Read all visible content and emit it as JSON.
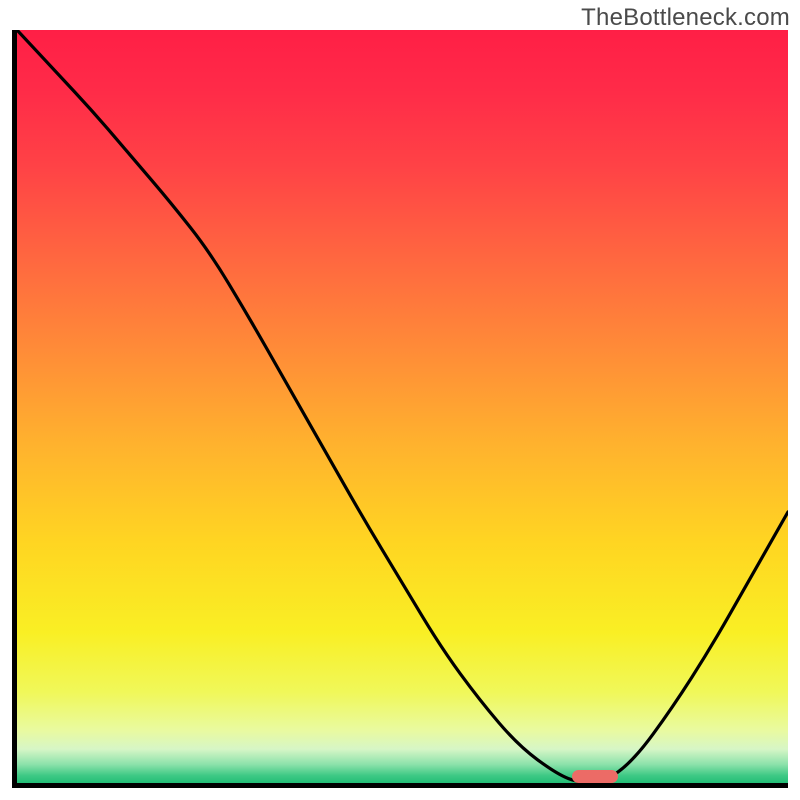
{
  "watermark": "TheBottleneck.com",
  "colors": {
    "gradient_stops": [
      {
        "offset": 0.0,
        "color": "#ff1f46"
      },
      {
        "offset": 0.08,
        "color": "#ff2b48"
      },
      {
        "offset": 0.18,
        "color": "#ff4246"
      },
      {
        "offset": 0.3,
        "color": "#ff6640"
      },
      {
        "offset": 0.42,
        "color": "#ff8a38"
      },
      {
        "offset": 0.55,
        "color": "#ffb22e"
      },
      {
        "offset": 0.68,
        "color": "#ffd522"
      },
      {
        "offset": 0.8,
        "color": "#f9ef24"
      },
      {
        "offset": 0.88,
        "color": "#f0f85a"
      },
      {
        "offset": 0.93,
        "color": "#e9faa0"
      },
      {
        "offset": 0.955,
        "color": "#d7f6c6"
      },
      {
        "offset": 0.975,
        "color": "#8de2ab"
      },
      {
        "offset": 0.99,
        "color": "#3ec985"
      },
      {
        "offset": 1.0,
        "color": "#23be76"
      }
    ],
    "curve": "#000000",
    "marker": "#ec6b66",
    "axis": "#000000"
  },
  "chart_data": {
    "type": "line",
    "title": "",
    "xlabel": "",
    "ylabel": "",
    "xlim": [
      0,
      100
    ],
    "ylim": [
      0,
      100
    ],
    "x": [
      0,
      5,
      10,
      15,
      20,
      25,
      30,
      35,
      40,
      45,
      50,
      55,
      60,
      65,
      70,
      73,
      76,
      80,
      85,
      90,
      95,
      100
    ],
    "values": [
      100,
      94.5,
      89,
      83,
      77,
      70.5,
      62,
      53,
      44,
      35,
      26.5,
      18,
      11,
      5,
      1.2,
      0,
      0,
      3,
      10,
      18,
      27,
      36
    ],
    "note": "y = bottleneck percentage (0 at valley ~x=73-76); marker at valley floor",
    "marker": {
      "x_start": 72,
      "x_end": 78,
      "y": 0.8
    }
  }
}
